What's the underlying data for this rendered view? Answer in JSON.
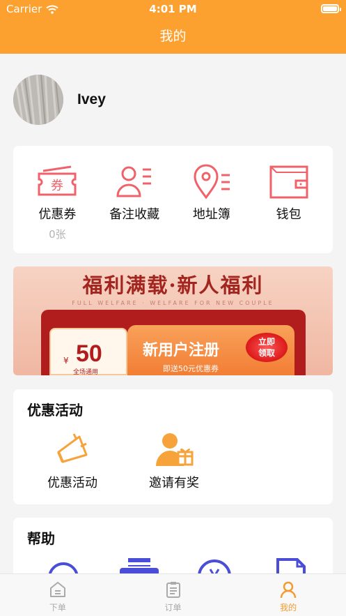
{
  "status_bar": {
    "carrier": "Carrier",
    "time": "4:01 PM"
  },
  "nav": {
    "title": "我的"
  },
  "profile": {
    "username": "Ivey"
  },
  "quick_actions": [
    {
      "icon": "ticket-icon",
      "label": "优惠券",
      "sub": "0张",
      "glyph": "券"
    },
    {
      "icon": "contact-card-icon",
      "label": "备注收藏"
    },
    {
      "icon": "location-pin-icon",
      "label": "地址簿"
    },
    {
      "icon": "wallet-icon",
      "label": "钱包"
    }
  ],
  "banner": {
    "title": "福利满载·新人福利",
    "subtitle": "FULL WELFARE · WELFARE FOR NEW COUPLE",
    "ticket_currency": "¥",
    "ticket_amount": "50",
    "ticket_note": "全场通用",
    "headline": "新用户注册",
    "note": "即送50元优惠券",
    "button_line1": "立即",
    "button_line2": "领取"
  },
  "promotions": {
    "title": "优惠活动",
    "items": [
      {
        "icon": "megaphone-icon",
        "label": "优惠活动"
      },
      {
        "icon": "invite-gift-icon",
        "label": "邀请有奖"
      }
    ]
  },
  "help": {
    "title": "帮助",
    "items": [
      {
        "icon": "customer-service-icon"
      },
      {
        "icon": "printer-icon"
      },
      {
        "icon": "refresh-icon"
      },
      {
        "icon": "document-icon"
      }
    ]
  },
  "tabbar": [
    {
      "icon": "home-icon",
      "label": "下单",
      "active": false
    },
    {
      "icon": "order-list-icon",
      "label": "订单",
      "active": false
    },
    {
      "icon": "user-icon",
      "label": "我的",
      "active": true
    }
  ],
  "colors": {
    "accent": "#fca12f",
    "icon_red": "#f0626a",
    "icon_orange": "#f5a33a",
    "icon_blue": "#4a4ed6"
  }
}
